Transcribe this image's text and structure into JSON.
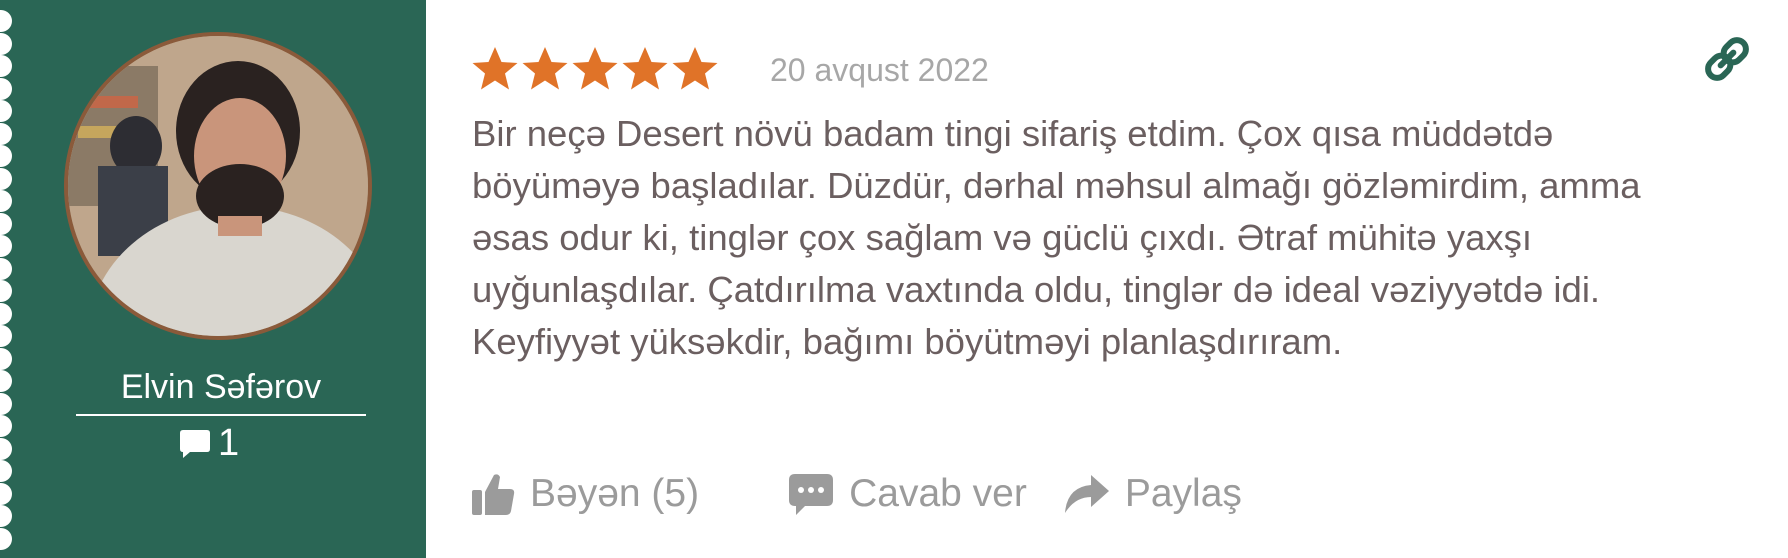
{
  "author": {
    "name": "Elvin Səfərov",
    "comment_count": "1",
    "icons": {
      "avatar": "user-photo",
      "comments": "speech-bubble-icon"
    }
  },
  "review": {
    "rating": 5,
    "max_rating": 5,
    "date": "20 avqust 2022",
    "text": "Bir neçə Desert növü badam tingi sifariş etdim. Çox qısa müddətdə böyüməyə başladılar. Düzdür, dərhal məhsul almağı gözləmirdim, amma əsas odur ki, tinglər çox sağlam və güclü çıxdı. Ətraf mühitə yaxşı uyğunlaşdılar. Çatdırılma vaxtında oldu, tinglər də ideal vəziyyətdə idi. Keyfiyyət yüksəkdir, bağımı böyütməyi planlaşdırıram."
  },
  "actions": {
    "like_label": "Bəyən (5)",
    "reply_label": "Cavab ver",
    "share_label": "Paylaş"
  },
  "colors": {
    "sidebar": "#2a6655",
    "star": "#e07328",
    "link_icon": "#2a6655",
    "text": "#6b5f60",
    "muted": "#9b9b9b"
  }
}
